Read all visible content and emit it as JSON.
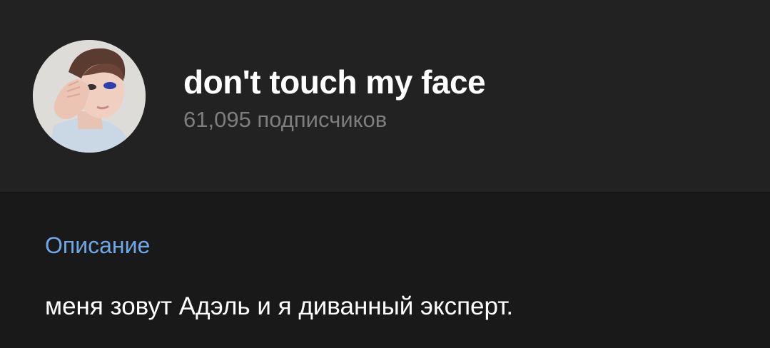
{
  "channel": {
    "name": "don't touch my face",
    "subscribers": "61,095 подписчиков"
  },
  "description": {
    "title": "Описание",
    "text": "меня зовут Адэль и я диванный эксперт."
  },
  "colors": {
    "header_bg": "#222222",
    "page_bg": "#191919",
    "accent": "#6fa8e8",
    "muted_text": "#7e7e7e"
  },
  "icons": {
    "avatar": "channel-avatar-photo"
  }
}
